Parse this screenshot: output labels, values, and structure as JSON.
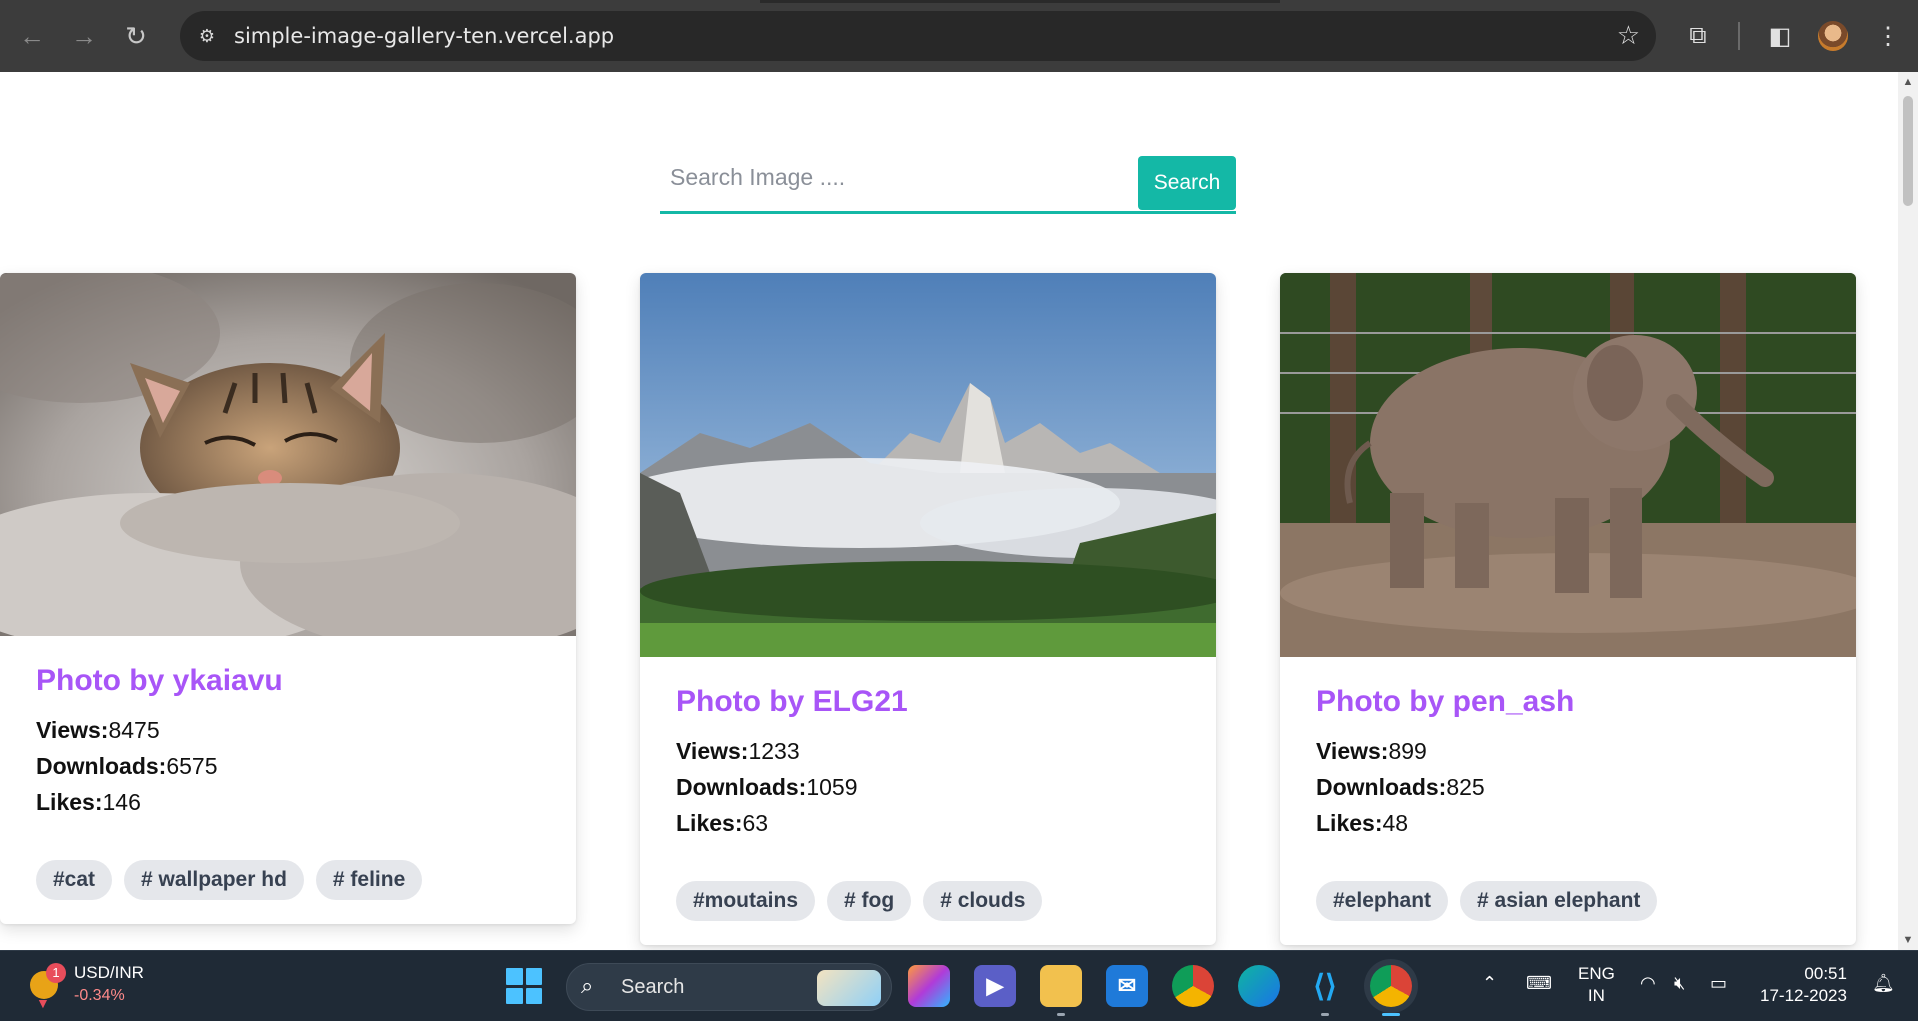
{
  "browser": {
    "url": "simple-image-gallery-ten.vercel.app"
  },
  "search": {
    "placeholder": "Search Image ....",
    "button_label": "Search",
    "accent_color": "#14b8a6"
  },
  "cards": [
    {
      "title": "Photo by ykaiavu",
      "views_label": "Views:",
      "views": "8475",
      "downloads_label": "Downloads:",
      "downloads": "6575",
      "likes_label": "Likes:",
      "likes": "146",
      "tags": [
        "#cat",
        "# wallpaper hd",
        "# feline"
      ],
      "image_subject": "sleeping tabby cat on fluffy blanket"
    },
    {
      "title": "Photo by ELG21",
      "views_label": "Views:",
      "views": "1233",
      "downloads_label": "Downloads:",
      "downloads": "1059",
      "likes_label": "Likes:",
      "likes": "63",
      "tags": [
        "#moutains",
        "# fog",
        "# clouds"
      ],
      "image_subject": "mountain peaks above fog and forest"
    },
    {
      "title": "Photo by pen_ash",
      "views_label": "Views:",
      "views": "899",
      "downloads_label": "Downloads:",
      "downloads": "825",
      "likes_label": "Likes:",
      "likes": "48",
      "tags": [
        "#elephant",
        "# asian elephant"
      ],
      "image_subject": "young elephant walking in enclosure"
    }
  ],
  "taskbar": {
    "widget_title": "USD/INR",
    "widget_change": "-0.34%",
    "widget_badge": "1",
    "search_label": "Search",
    "lang_line1": "ENG",
    "lang_line2": "IN",
    "time": "00:51",
    "date": "17-12-2023"
  }
}
